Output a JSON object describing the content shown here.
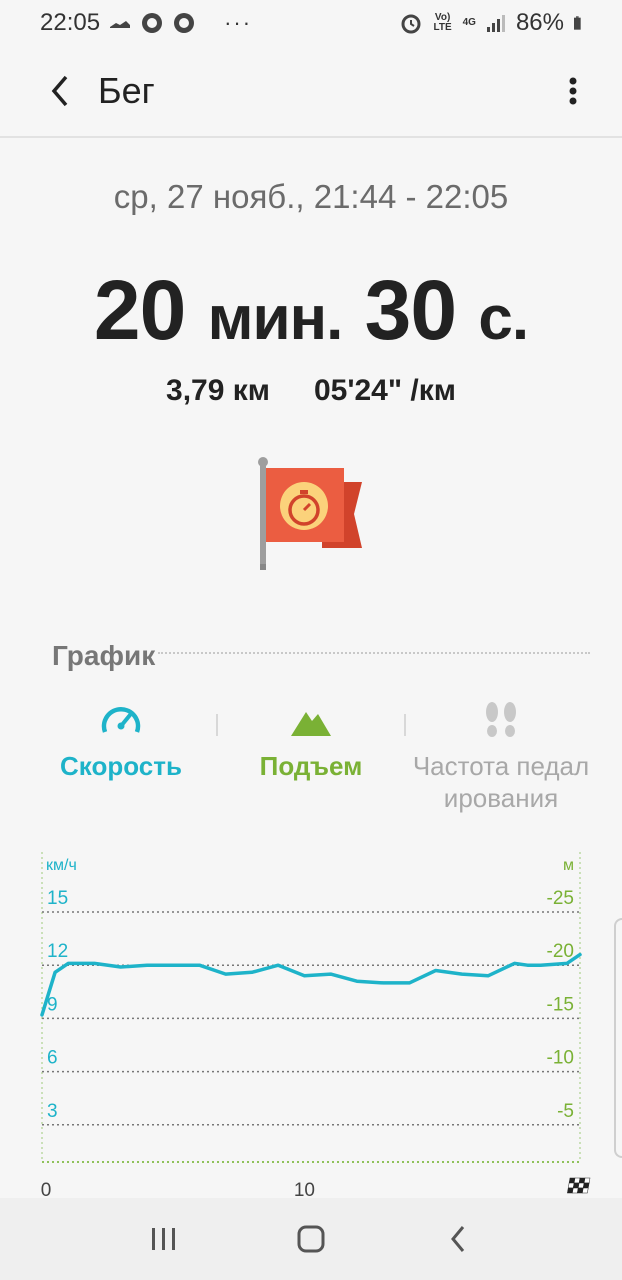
{
  "status": {
    "time": "22:05",
    "dots": "···",
    "volte": "Vo) LTE",
    "net": "4G",
    "battery": "86%"
  },
  "app_bar": {
    "title": "Бег"
  },
  "summary": {
    "date_range": "ср, 27 нояб., 21:44 - 22:05",
    "duration_min_value": "20",
    "duration_min_unit": "мин.",
    "duration_sec_value": "30",
    "duration_sec_unit": "с.",
    "distance": "3,79 км",
    "pace": "05'24\" /км"
  },
  "graph": {
    "title": "График",
    "tabs": [
      {
        "label": "Скорость",
        "icon": "speedometer-icon",
        "color": "#1eb3c9"
      },
      {
        "label": "Подъем",
        "icon": "mountain-icon",
        "color": "#7ab135"
      },
      {
        "label": "Частота педал ирования",
        "icon": "footprints-icon",
        "color": "#aaaaaa"
      }
    ]
  },
  "chart_data": {
    "type": "line",
    "left_axis": {
      "label": "км/ч",
      "ticks": [
        "15",
        "12",
        "9",
        "6",
        "3"
      ],
      "ylim": [
        0,
        15
      ]
    },
    "right_axis": {
      "label": "м",
      "ticks": [
        "-25",
        "-20",
        "-15",
        "-10",
        "-5"
      ],
      "ylim": [
        0,
        -25
      ]
    },
    "x_ticks": [
      "0",
      "10"
    ],
    "xlim": [
      0,
      20.5
    ],
    "series": [
      {
        "color": "#1eb3c9",
        "x": [
          0,
          0.5,
          1,
          2,
          3,
          4,
          5,
          6,
          7,
          8,
          9,
          10,
          11,
          12,
          13,
          14,
          15,
          16,
          17,
          18,
          18.5,
          19,
          20,
          20.5
        ],
        "y": [
          9.2,
          11.6,
          12.1,
          12.1,
          11.9,
          12.0,
          12.0,
          12.0,
          11.5,
          11.6,
          12.0,
          11.4,
          11.5,
          11.1,
          11.0,
          11.0,
          11.7,
          11.5,
          11.4,
          12.1,
          12.0,
          12.0,
          12.1,
          12.6
        ]
      }
    ],
    "colors": {
      "left": "#1eb3c9",
      "right": "#7ab135"
    }
  }
}
